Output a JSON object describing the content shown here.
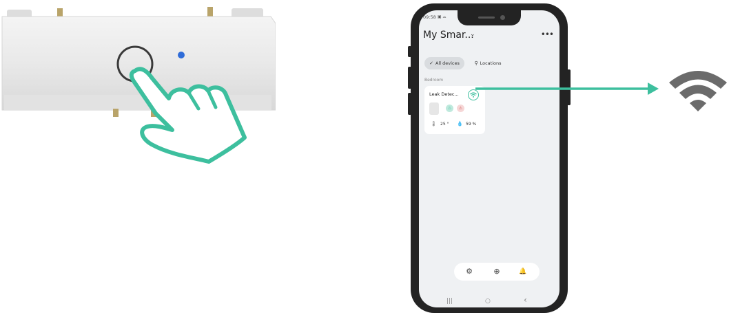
{
  "phone": {
    "status_time": "09:58",
    "status_icons": "▣ ⌓",
    "home_title": "My Smar...",
    "title_chevron": "⌄",
    "more_menu": "•••",
    "tabs": [
      {
        "label": "All devices",
        "icon": "✓",
        "selected": true
      },
      {
        "label": "Locations",
        "icon": "⚲",
        "selected": false
      }
    ],
    "room_label": "Bedroom",
    "device_card": {
      "name": "Leak Detec...",
      "temperature": "25 °",
      "humidity": "59 %"
    },
    "bottom_bar": {
      "settings_icon": "⚙",
      "add_icon": "⊕",
      "bell_icon": "🔔"
    },
    "sys_nav": {
      "recent": "|||",
      "home": "○",
      "back": "‹"
    }
  },
  "colors": {
    "accent": "#3dbf9e",
    "phone_frame": "#232323",
    "screen_bg": "#eff1f3",
    "wifi_gray": "#6b6b6b"
  },
  "icons": [
    "hand-press-icon",
    "wifi-icon",
    "arrow-right-icon",
    "settings-icon",
    "add-icon",
    "bell-icon",
    "thermometer-icon",
    "droplet-icon"
  ]
}
